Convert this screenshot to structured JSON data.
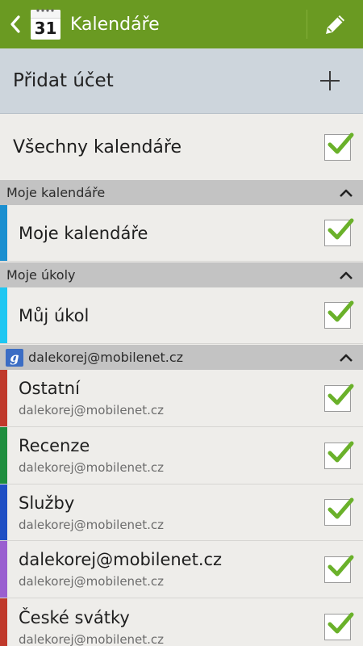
{
  "actionbar": {
    "title": "Kalendáře",
    "app_icon_day": "31",
    "icons": [
      "back-arrow-icon",
      "calendar-app-icon",
      "pencil-icon"
    ],
    "color": "#6a9a22"
  },
  "add_account": {
    "label": "Přidat účet",
    "icon": "plus-icon"
  },
  "all_calendars": {
    "label": "Všechny kalendáře",
    "checked": true
  },
  "sections": [
    {
      "title": "Moje kalendáře",
      "items": [
        {
          "name": "Moje kalendáře",
          "color": "#1a8fd0",
          "checked": true
        }
      ]
    },
    {
      "title": "Moje úkoly",
      "items": [
        {
          "name": "Můj úkol",
          "color": "#1ec7f2",
          "checked": true
        }
      ]
    },
    {
      "title": "dalekorej@mobilenet.cz",
      "icon": "google-icon",
      "items": [
        {
          "name": "Ostatní",
          "sub": "dalekorej@mobilenet.cz",
          "color": "#c0392b",
          "checked": true
        },
        {
          "name": "Recenze",
          "sub": "dalekorej@mobilenet.cz",
          "color": "#1e8e3e",
          "checked": true
        },
        {
          "name": "Služby",
          "sub": "dalekorej@mobilenet.cz",
          "color": "#1f4fc4",
          "checked": true
        },
        {
          "name": "dalekorej@mobilenet.cz",
          "sub": "dalekorej@mobilenet.cz",
          "color": "#9a5fd0",
          "checked": true
        },
        {
          "name": "České svátky",
          "sub": "dalekorej@mobilenet.cz",
          "color": "#c0392b",
          "checked": true
        }
      ]
    }
  ],
  "checkmark_color": "#6ab12a"
}
